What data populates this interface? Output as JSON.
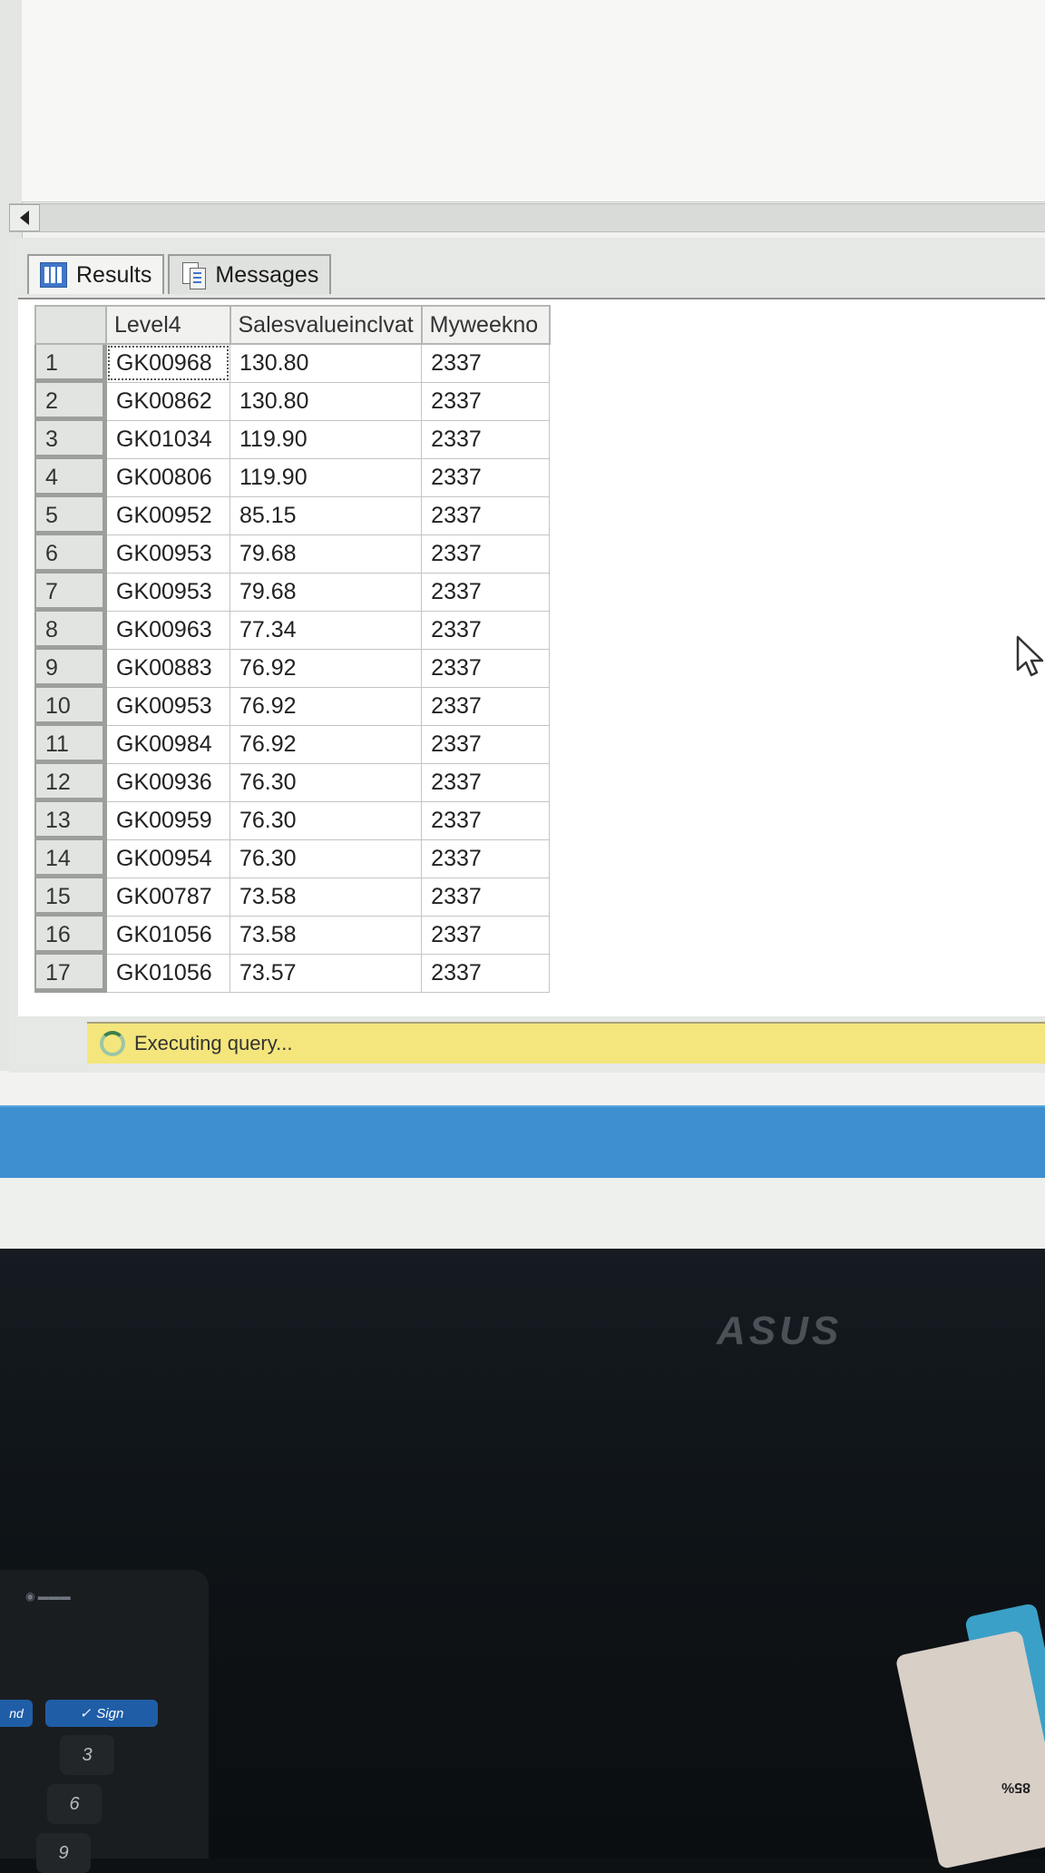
{
  "results_pane": {
    "tabs": [
      {
        "label": "Results",
        "icon": "results-grid-icon",
        "active": true
      },
      {
        "label": "Messages",
        "icon": "messages-icon",
        "active": false
      }
    ]
  },
  "grid": {
    "columns": [
      "Level4",
      "Salesvalueinclvat",
      "Myweekno"
    ],
    "rows": [
      {
        "n": "1",
        "level4": "GK00968",
        "sales": "130.80",
        "week": "2337"
      },
      {
        "n": "2",
        "level4": "GK00862",
        "sales": "130.80",
        "week": "2337"
      },
      {
        "n": "3",
        "level4": "GK01034",
        "sales": "119.90",
        "week": "2337"
      },
      {
        "n": "4",
        "level4": "GK00806",
        "sales": "119.90",
        "week": "2337"
      },
      {
        "n": "5",
        "level4": "GK00952",
        "sales": "85.15",
        "week": "2337"
      },
      {
        "n": "6",
        "level4": "GK00953",
        "sales": "79.68",
        "week": "2337"
      },
      {
        "n": "7",
        "level4": "GK00953",
        "sales": "79.68",
        "week": "2337"
      },
      {
        "n": "8",
        "level4": "GK00963",
        "sales": "77.34",
        "week": "2337"
      },
      {
        "n": "9",
        "level4": "GK00883",
        "sales": "76.92",
        "week": "2337"
      },
      {
        "n": "10",
        "level4": "GK00953",
        "sales": "76.92",
        "week": "2337"
      },
      {
        "n": "11",
        "level4": "GK00984",
        "sales": "76.92",
        "week": "2337"
      },
      {
        "n": "12",
        "level4": "GK00936",
        "sales": "76.30",
        "week": "2337"
      },
      {
        "n": "13",
        "level4": "GK00959",
        "sales": "76.30",
        "week": "2337"
      },
      {
        "n": "14",
        "level4": "GK00954",
        "sales": "76.30",
        "week": "2337"
      },
      {
        "n": "15",
        "level4": "GK00787",
        "sales": "73.58",
        "week": "2337"
      },
      {
        "n": "16",
        "level4": "GK01056",
        "sales": "73.58",
        "week": "2337"
      },
      {
        "n": "17",
        "level4": "GK01056",
        "sales": "73.57",
        "week": "2337"
      }
    ]
  },
  "status": {
    "text": "Executing query..."
  },
  "device": {
    "monitor_brand": "ASUS",
    "terminal_end_label": "nd",
    "terminal_sign_label": "Sign",
    "terminal_keys": [
      "3",
      "6",
      "9"
    ],
    "card_text": "85%"
  }
}
